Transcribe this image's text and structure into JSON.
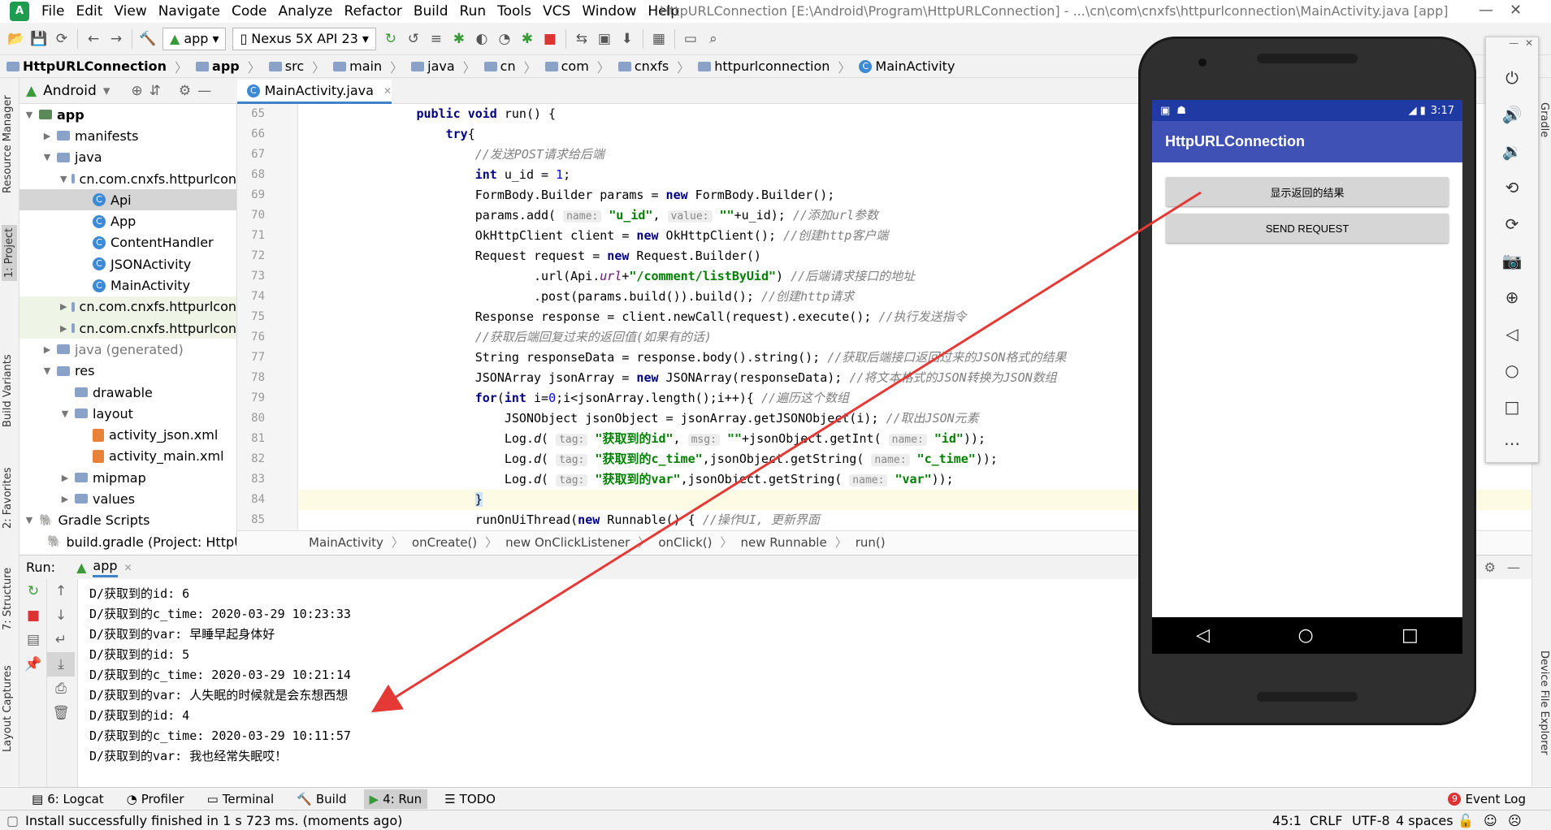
{
  "menubar": {
    "items": [
      "File",
      "Edit",
      "View",
      "Navigate",
      "Code",
      "Analyze",
      "Refactor",
      "Build",
      "Run",
      "Tools",
      "VCS",
      "Window",
      "Help"
    ],
    "window_title": "HttpURLConnection [E:\\Android\\Program\\HttpURLConnection] - ...\\cn\\com\\cnxfs\\httpurlconnection\\MainActivity.java [app]"
  },
  "toolbar": {
    "config": "app",
    "device": "Nexus 5X API 23"
  },
  "breadcrumb": [
    "HttpURLConnection",
    "app",
    "src",
    "main",
    "java",
    "cn",
    "com",
    "cnxfs",
    "httpurlconnection",
    "MainActivity"
  ],
  "project_panel": {
    "view_mode": "Android",
    "tree": [
      {
        "label": "app",
        "indent": 0,
        "arrow": "▼",
        "type": "module",
        "bold": true
      },
      {
        "label": "manifests",
        "indent": 1,
        "arrow": "▶",
        "type": "folder"
      },
      {
        "label": "java",
        "indent": 1,
        "arrow": "▼",
        "type": "folder"
      },
      {
        "label": "cn.com.cnxfs.httpurlcon",
        "indent": 2,
        "arrow": "▼",
        "type": "package"
      },
      {
        "label": "Api",
        "indent": 3,
        "arrow": "",
        "type": "class",
        "selected": true
      },
      {
        "label": "App",
        "indent": 3,
        "arrow": "",
        "type": "class"
      },
      {
        "label": "ContentHandler",
        "indent": 3,
        "arrow": "",
        "type": "class"
      },
      {
        "label": "JSONActivity",
        "indent": 3,
        "arrow": "",
        "type": "class"
      },
      {
        "label": "MainActivity",
        "indent": 3,
        "arrow": "",
        "type": "class"
      },
      {
        "label": "cn.com.cnxfs.httpurlcon",
        "indent": 2,
        "arrow": "▶",
        "type": "package",
        "highlight": true
      },
      {
        "label": "cn.com.cnxfs.httpurlcon",
        "indent": 2,
        "arrow": "▶",
        "type": "package",
        "highlight": true
      },
      {
        "label": "java (generated)",
        "indent": 1,
        "arrow": "▶",
        "type": "folder",
        "muted": true
      },
      {
        "label": "res",
        "indent": 1,
        "arrow": "▼",
        "type": "folder"
      },
      {
        "label": "drawable",
        "indent": 2,
        "arrow": "",
        "type": "folder"
      },
      {
        "label": "layout",
        "indent": 2,
        "arrow": "▼",
        "type": "folder"
      },
      {
        "label": "activity_json.xml",
        "indent": 3,
        "arrow": "",
        "type": "xml"
      },
      {
        "label": "activity_main.xml",
        "indent": 3,
        "arrow": "",
        "type": "xml"
      },
      {
        "label": "mipmap",
        "indent": 2,
        "arrow": "▶",
        "type": "folder"
      },
      {
        "label": "values",
        "indent": 2,
        "arrow": "▶",
        "type": "folder"
      },
      {
        "label": "Gradle Scripts",
        "indent": 0,
        "arrow": "▼",
        "type": "gradle"
      },
      {
        "label": "build.gradle (Project: HttpU",
        "indent": 1,
        "arrow": "",
        "type": "gradle"
      }
    ]
  },
  "editor": {
    "file_tab": "MainActivity.java",
    "line_numbers": [
      "65",
      "66",
      "67",
      "68",
      "69",
      "70",
      "71",
      "72",
      "73",
      "74",
      "75",
      "76",
      "77",
      "78",
      "79",
      "80",
      "81",
      "82",
      "83",
      "84",
      "85"
    ],
    "code_lines": [
      "<span class=\"kw\">public void</span> run() {",
      "    <span class=\"kw\">try</span>{",
      "        <span class=\"cm\">//发送POST请求给后端</span>",
      "        <span class=\"kw\">int</span> u_id = <span class=\"nm\">1</span>;",
      "        FormBody.Builder params = <span class=\"kw\">new</span> FormBody.Builder();",
      "        params.add( <span class=\"hint\">name:</span> <span class=\"st\">\"u_id\"</span>, <span class=\"hint\">value:</span> <span class=\"st\">\"\"</span>+u_id); <span class=\"cm\">//添加url参数</span>",
      "        OkHttpClient client = <span class=\"kw\">new</span> OkHttpClient(); <span class=\"cm\">//创建http客户端</span>",
      "        Request request = <span class=\"kw\">new</span> Request.Builder()",
      "                .url(Api.<i style=\"color:#660e7a\">url</i>+<span class=\"st\">\"/comment/listByUid\"</span>) <span class=\"cm\">//后端请求接口的地址</span>",
      "                .post(params.build()).build(); <span class=\"cm\">//创建http请求</span>",
      "        Response response = client.newCall(request).execute(); <span class=\"cm\">//执行发送指令</span>",
      "        <span class=\"cm\">//获取后端回复过来的返回值(如果有的话)</span>",
      "        String responseData = response.body().string(); <span class=\"cm\">//获取后端接口返回过来的JSON格式的结果</span>",
      "        JSONArray jsonArray = <span class=\"kw\">new</span> JSONArray(responseData); <span class=\"cm\">//将文本格式的JSON转换为JSON数组</span>",
      "        <span class=\"kw\">for</span>(<span class=\"kw\">int</span> i=<span class=\"nm\">0</span>;i&lt;jsonArray.length();i++){ <span class=\"cm\">//遍历这个数组</span>",
      "            JSONObject jsonObject = jsonArray.getJSONObject(i); <span class=\"cm\">//取出JSON元素</span>",
      "            Log.<i>d</i>( <span class=\"hint\">tag:</span> <span class=\"st\">\"获取到的id\"</span>, <span class=\"hint\">msg:</span> <span class=\"st\">\"\"</span>+jsonObject.getInt( <span class=\"hint\">name:</span> <span class=\"st\">\"id\"</span>));",
      "            Log.<i>d</i>( <span class=\"hint\">tag:</span> <span class=\"st\">\"获取到的c_time\"</span>,jsonObject.getString( <span class=\"hint\">name:</span> <span class=\"st\">\"c_time\"</span>));",
      "            Log.<i>d</i>( <span class=\"hint\">tag:</span> <span class=\"st\">\"获取到的var\"</span>,jsonObject.getString( <span class=\"hint\">name:</span> <span class=\"st\">\"var\"</span>));",
      "        <span style=\"background:#cde4ff\">}</span>",
      "        runOnUiThread(<span class=\"kw\">new</span> Runnable() { <span class=\"cm\">//操作UI, 更新界面</span>"
    ],
    "code_bar": [
      "MainActivity",
      "onCreate()",
      "new OnClickListener",
      "onClick()",
      "new Runnable",
      "run()"
    ]
  },
  "run_panel": {
    "label": "Run:",
    "config": "app",
    "output": [
      "D/获取到的id: 6",
      "D/获取到的c_time: 2020-03-29 10:23:33",
      "D/获取到的var: 早睡早起身体好",
      "D/获取到的id: 5",
      "D/获取到的c_time: 2020-03-29 10:21:14",
      "D/获取到的var: 人失眠的时候就是会东想西想",
      "D/获取到的id: 4",
      "D/获取到的c_time: 2020-03-29 10:11:57",
      "D/获取到的var: 我也经常失眠哎！"
    ]
  },
  "bottom_tabs": {
    "logcat": "6: Logcat",
    "profiler": "Profiler",
    "terminal": "Terminal",
    "build": "Build",
    "run": "4: Run",
    "todo": "TODO",
    "event_log": "Event Log",
    "event_count": "9"
  },
  "status_bar": {
    "message": "Install successfully finished in 1 s 723 ms. (moments ago)",
    "position": "45:1",
    "line_sep": "CRLF",
    "encoding": "UTF-8",
    "indent": "4 spaces"
  },
  "side_tabs": {
    "left": [
      "Resource Manager",
      "1: Project",
      "Build Variants",
      "2: Favorites",
      "7: Structure",
      "Layout Captures"
    ],
    "right": [
      "Gradle",
      "Device File Explorer"
    ]
  },
  "emulator": {
    "time": "3:17",
    "app_title": "HttpURLConnection",
    "button_result": "显示返回的结果",
    "button_send": "SEND REQUEST"
  },
  "colors": {
    "accent": "#3f51b5",
    "annotation_arrow": "#e53935"
  }
}
